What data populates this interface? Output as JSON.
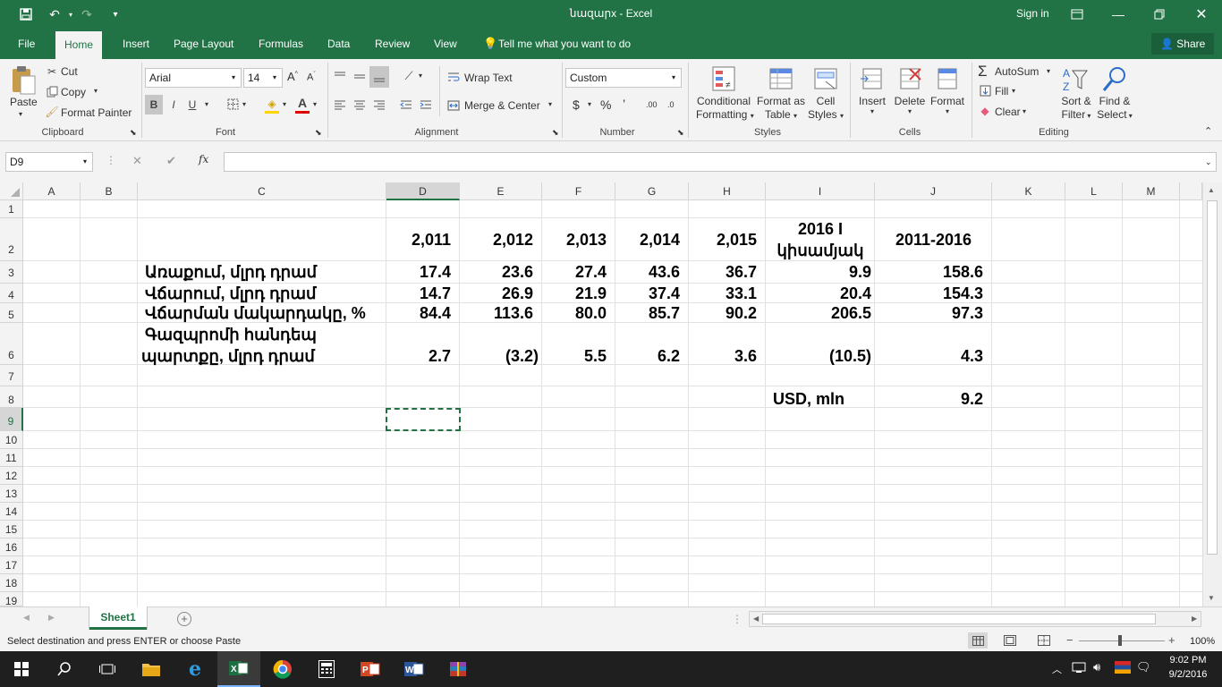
{
  "window": {
    "title": "նազարx - Excel",
    "sign_in": "Sign in"
  },
  "ribbon_tabs": [
    "File",
    "Home",
    "Insert",
    "Page Layout",
    "Formulas",
    "Data",
    "Review",
    "View"
  ],
  "tell_me": "Tell me what you want to do",
  "share": "Share",
  "clipboard": {
    "paste": "Paste",
    "cut": "Cut",
    "copy": "Copy",
    "format_painter": "Format Painter",
    "label": "Clipboard"
  },
  "font": {
    "name": "Arial",
    "size": "14",
    "label": "Font",
    "bold": "B",
    "italic": "I",
    "underline": "U"
  },
  "alignment": {
    "wrap_text": "Wrap Text",
    "merge_center": "Merge & Center",
    "label": "Alignment"
  },
  "number": {
    "format": "Custom",
    "label": "Number",
    "dollar": "$",
    "percent": "%",
    "comma": "’",
    "inc_dec": ".00",
    "dec_dec": ".0"
  },
  "styles": {
    "conditional": "Conditional",
    "conditional2": "Formatting",
    "format_as": "Format as",
    "format_as2": "Table",
    "cell": "Cell",
    "cell2": "Styles",
    "label": "Styles"
  },
  "cells": {
    "insert": "Insert",
    "delete": "Delete",
    "format": "Format",
    "label": "Cells"
  },
  "editing": {
    "autosum": "AutoSum",
    "fill": "Fill",
    "clear": "Clear",
    "sort": "Sort &",
    "sort2": "Filter",
    "find": "Find &",
    "find2": "Select",
    "label": "Editing"
  },
  "formula_bar": {
    "name_box": "D9",
    "fx": "fx",
    "cancel": "✕",
    "enter": "✔",
    "value": ""
  },
  "columns": [
    "A",
    "B",
    "C",
    "D",
    "E",
    "F",
    "G",
    "H",
    "I",
    "J",
    "K",
    "L",
    "M"
  ],
  "rows": [
    "1",
    "2",
    "3",
    "4",
    "5",
    "6",
    "7",
    "8",
    "9",
    "10",
    "11",
    "12",
    "13",
    "14",
    "15",
    "16",
    "17",
    "18",
    "19"
  ],
  "sheet": {
    "header": [
      "2,011",
      "2,012",
      "2,013",
      "2,014",
      "2,015",
      "2016 I",
      "կիսամյակ",
      "2011-2016"
    ],
    "r3": {
      "label": "Առաքում, մլրդ դրամ",
      "vals": [
        "17.4",
        "23.6",
        "27.4",
        "43.6",
        "36.7",
        "9.9",
        "158.6"
      ]
    },
    "r4": {
      "label": "Վճարում, մլրդ դրամ",
      "vals": [
        "14.7",
        "26.9",
        "21.9",
        "37.4",
        "33.1",
        "20.4",
        "154.3"
      ]
    },
    "r5": {
      "label": "Վճարման մակարդակը, %",
      "vals": [
        "84.4",
        "113.6",
        "80.0",
        "85.7",
        "90.2",
        "206.5",
        "97.3"
      ]
    },
    "r6": {
      "label1": "Գազպրոմի հանդեպ",
      "label2": "պարտքը, մլրդ դրամ",
      "vals": [
        "2.7",
        "(3.2)",
        "5.5",
        "6.2",
        "3.6",
        "(10.5)",
        "4.3"
      ]
    },
    "r8": {
      "label": "USD, mln",
      "val": "9.2"
    }
  },
  "sheet_tab": "Sheet1",
  "status": {
    "message": "Select destination and press ENTER or choose Paste",
    "zoom": "100%"
  },
  "taskbar": {
    "time": "9:02 PM",
    "date": "9/2/2016"
  },
  "colors": {
    "excel_green": "#217346",
    "taskbar": "#1f1f1f"
  }
}
